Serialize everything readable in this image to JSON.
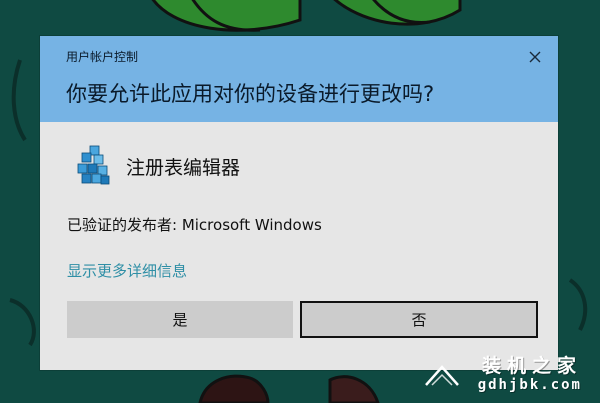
{
  "dialog": {
    "caption": "用户帐户控制",
    "question": "你要允许此应用对你的设备进行更改吗?",
    "app_name": "注册表编辑器",
    "publisher": "已验证的发布者: Microsoft Windows",
    "details_link": "显示更多详细信息",
    "yes_label": "是",
    "no_label": "否"
  },
  "watermark": {
    "title": "装机之家",
    "url": "gdhjbk.com"
  },
  "colors": {
    "header": "#76b3e4",
    "dialog_body": "#e6e6e6",
    "link": "#2f8fa6",
    "button": "#cccccc",
    "wallpaper": "#0f4a42"
  },
  "icons": {
    "app": "registry-editor-icon",
    "close": "close-icon"
  }
}
